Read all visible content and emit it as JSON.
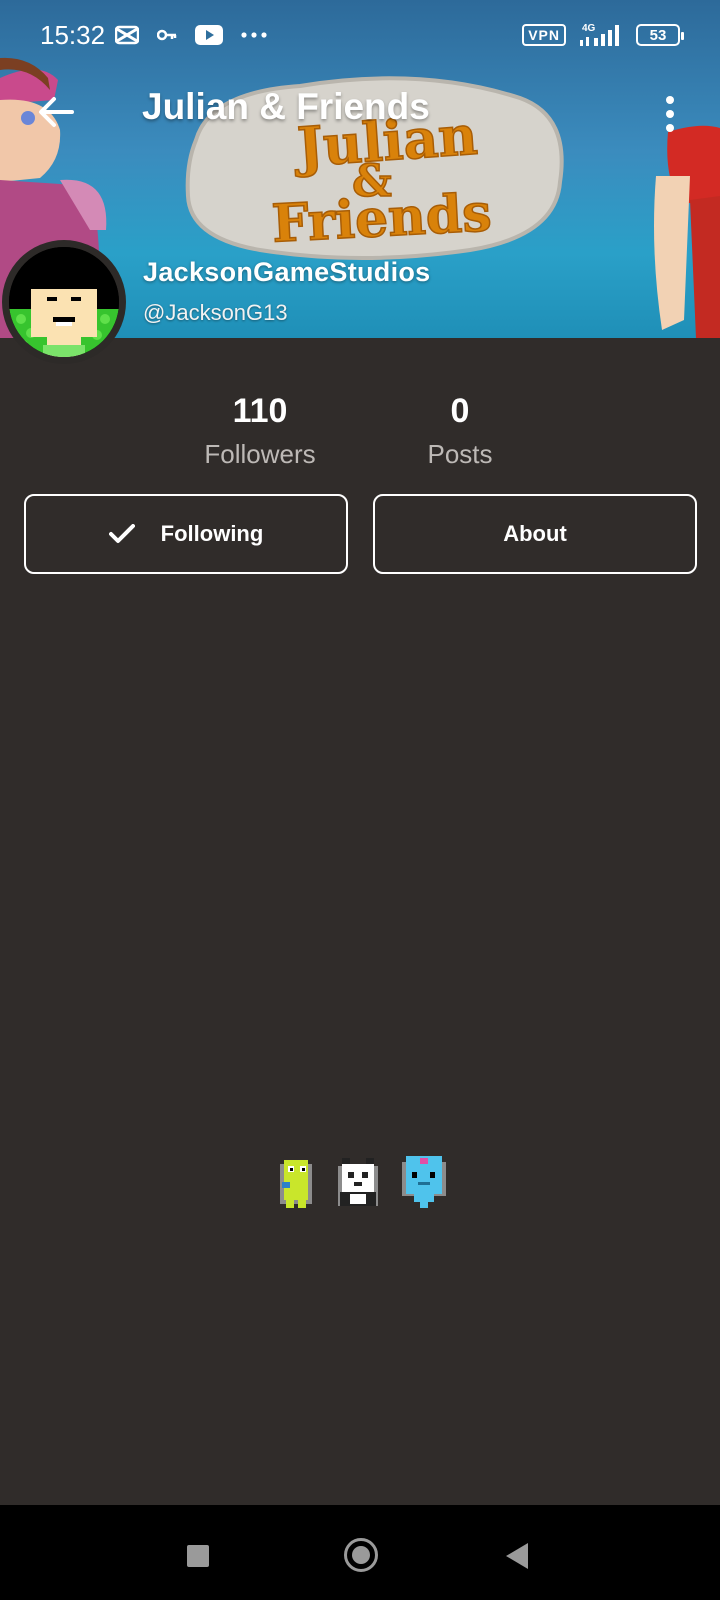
{
  "status_bar": {
    "time": "15:32",
    "vpn_label": "VPN",
    "network_type": "4G",
    "battery_level": "53",
    "left_icons": [
      "capcut-icon",
      "key-icon",
      "youtube-icon",
      "more-notifications-icon"
    ]
  },
  "app_bar": {
    "title": "Julian & Friends",
    "back_icon": "arrow-left-icon",
    "menu_icon": "more-vertical-icon"
  },
  "banner": {
    "logo_line1": "Julian",
    "logo_line2": "&",
    "logo_line3": "Friends"
  },
  "profile": {
    "display_name": "JacksonGameStudios",
    "handle": "@JacksonG13"
  },
  "stats": {
    "followers_value": "110",
    "followers_label": "Followers",
    "posts_value": "0",
    "posts_label": "Posts"
  },
  "actions": {
    "following_label": "Following",
    "following_icon": "checkmark-icon",
    "about_label": "About"
  },
  "colors": {
    "background": "#302c2a",
    "banner_sky": "#2aa0c8",
    "logo_orange": "#d9820a",
    "muted_text": "#bdb9b6",
    "nav_bar": "#000000"
  }
}
